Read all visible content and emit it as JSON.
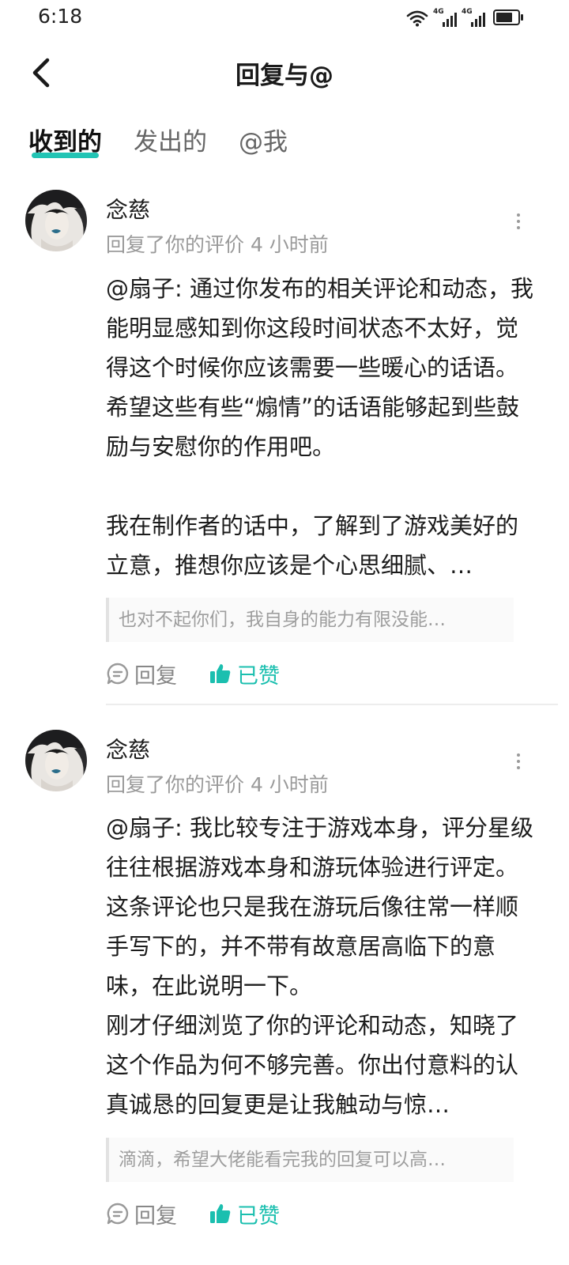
{
  "status_bar": {
    "time": "6:18",
    "sim1": "4G",
    "sim2": "4G"
  },
  "header": {
    "title": "回复与@",
    "back_icon": "chevron-left-icon"
  },
  "tabs": [
    {
      "label": "收到的",
      "active": true
    },
    {
      "label": "发出的",
      "active": false
    },
    {
      "label": "@我",
      "active": false
    }
  ],
  "notifications": [
    {
      "author": "念慈",
      "meta": "回复了你的评价 4 小时前",
      "paragraphs": [
        "@扇子: 通过你发布的相关评论和动态，我能明显感知到你这段时间状态不太好，觉得这个时候你应该需要一些暖心的话语。希望这些有些“煽情”的话语能够起到些鼓励与安慰你的作用吧。",
        "",
        "我在制作者的话中，了解到了游戏美好的立意，推想你应该是个心思细腻、…"
      ],
      "quote": "也对不起你们，我自身的能力有限没能…",
      "reply_label": "回复",
      "like_label": "已赞"
    },
    {
      "author": "念慈",
      "meta": "回复了你的评价 4 小时前",
      "paragraphs": [
        "@扇子: 我比较专注于游戏本身，评分星级往往根据游戏本身和游玩体验进行评定。这条评论也只是我在游玩后像往常一样顺手写下的，并不带有故意居高临下的意味，在此说明一下。",
        "刚才仔细浏览了你的评论和动态，知晓了这个作品为何不够完善。你出付意料的认真诚恳的回复更是让我触动与惊…"
      ],
      "quote": "滴滴，希望大佬能看完我的回复可以高…",
      "reply_label": "回复",
      "like_label": "已赞"
    }
  ],
  "colors": {
    "accent": "#1bbfaf",
    "tab_underline": "#22c4b4",
    "meta_text": "#9a9a9a"
  }
}
